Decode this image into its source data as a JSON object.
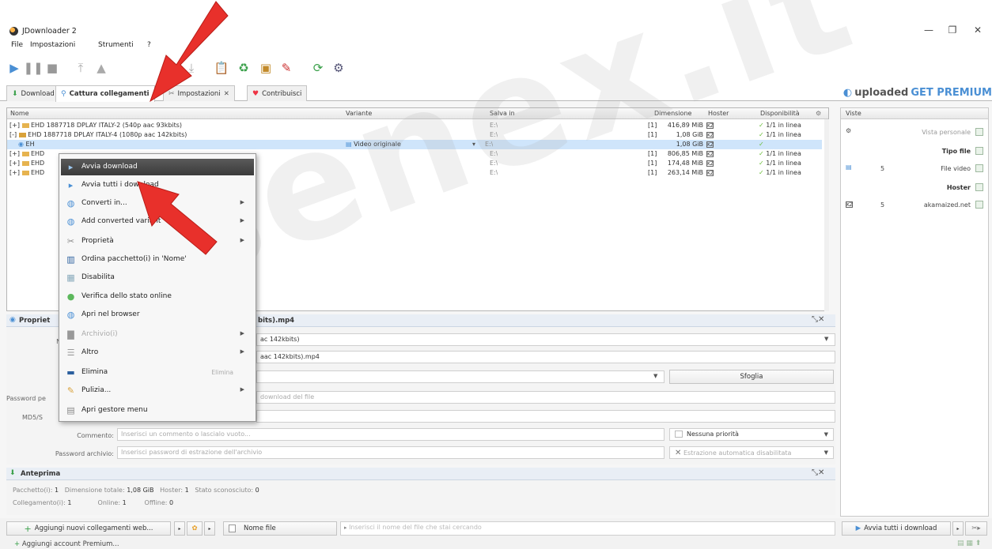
{
  "window": {
    "title": "JDownloader 2"
  },
  "menu": {
    "items": [
      "File",
      "Impostazioni",
      "Strumenti",
      "?"
    ]
  },
  "tabs": [
    {
      "label": "Download"
    },
    {
      "label": "Cattura collegamenti"
    },
    {
      "label": "Impostazioni"
    },
    {
      "label": "Contribuisci"
    }
  ],
  "promo": {
    "brand": "uploaded",
    "cta": "GET PREMIUM"
  },
  "grid": {
    "columns": [
      "Nome",
      "Variante",
      "Salva in",
      "Dimensione",
      "Hoster",
      "Disponibilità"
    ],
    "rows": [
      {
        "prefix": "[+]",
        "name": "EHD 1887718 DPLAY ITALY-2 (540p aac 93kbits)",
        "variant": "",
        "save": "E:\\",
        "count": "[1]",
        "size": "416,89 MiB",
        "hoster": "KZ",
        "avail": "1/1 in linea"
      },
      {
        "prefix": "[-]",
        "name": "EHD 1887718 DPLAY ITALY-4 (1080p aac 142kbits)",
        "variant": "",
        "save": "E:\\",
        "count": "[1]",
        "size": "1,08 GiB",
        "hoster": "KZ",
        "avail": "1/1 in linea"
      },
      {
        "prefix": "",
        "name": "EH",
        "variant": "Video originale",
        "save": "E:\\",
        "count": "",
        "size": "1,08 GiB",
        "hoster": "KZ",
        "avail": ""
      },
      {
        "prefix": "[+]",
        "name": "EHD",
        "variant": "",
        "save": "E:\\",
        "count": "[1]",
        "size": "806,85 MiB",
        "hoster": "KZ",
        "avail": "1/1 in linea"
      },
      {
        "prefix": "[+]",
        "name": "EHD",
        "variant": "",
        "save": "E:\\",
        "count": "[1]",
        "size": "174,48 MiB",
        "hoster": "KZ",
        "avail": "1/1 in linea"
      },
      {
        "prefix": "[+]",
        "name": "EHD",
        "variant": "",
        "save": "E:\\",
        "count": "[1]",
        "size": "263,14 MiB",
        "hoster": "KZ",
        "avail": "1/1 in linea"
      }
    ]
  },
  "side": {
    "header": "Viste",
    "rows": [
      {
        "label": "Vista personale",
        "count": ""
      },
      {
        "label": "Tipo file",
        "count": ""
      },
      {
        "label": "File video",
        "count": "5"
      },
      {
        "label": "Hoster",
        "count": ""
      },
      {
        "label": "akamaized.net",
        "count": "5"
      }
    ],
    "start_all": "Avvia tutti i download"
  },
  "context_menu": {
    "items": [
      {
        "label": "Avvia download",
        "icon": "play-icon"
      },
      {
        "label": "Avvia tutti i download",
        "icon": "play-all-icon"
      },
      {
        "label": "Converti in...",
        "icon": "convert-icon"
      },
      {
        "label": "Add converted variant",
        "icon": "add-variant-icon"
      },
      {
        "label": "Proprietà",
        "icon": "wrench-icon"
      },
      {
        "label": "Ordina pacchetto(i) in 'Nome'",
        "icon": "sort-icon"
      },
      {
        "label": "Disabilita",
        "icon": "disable-icon"
      },
      {
        "label": "Verifica dello stato online",
        "icon": "check-online-icon"
      },
      {
        "label": "Apri nel browser",
        "icon": "browser-icon"
      },
      {
        "label": "Archivio(i)",
        "icon": "archive-icon"
      },
      {
        "label": "Altro",
        "icon": "more-icon"
      },
      {
        "label": "Elimina",
        "icon": "delete-icon",
        "shortcut": "Elimina"
      },
      {
        "label": "Pulizia...",
        "icon": "broom-icon"
      },
      {
        "label": "Apri gestore menu",
        "icon": "menu-manager-icon"
      }
    ]
  },
  "props": {
    "title": "Propriet",
    "title_suffix": "bits).mp4",
    "name_label": "No",
    "row1_value": "ac 142kbits)",
    "row2_value": "aac 142kbits).mp4",
    "browse": "Sfoglia",
    "pw_label": "Password pe",
    "pw_placeholder": "download del file",
    "md5_label": "MD5/S",
    "comment_label": "Commento:",
    "comment_placeholder": "Inserisci un commento o lascialo vuoto...",
    "priority": "Nessuna priorità",
    "archive_pw_label": "Password archivio:",
    "archive_pw_placeholder": "Inserisci password di estrazione dell'archivio",
    "extraction": "Estrazione automatica disabilitata"
  },
  "preview": {
    "title": "Anteprima",
    "packages_label": "Pacchetto(i):",
    "packages": "1",
    "total_label": "Dimensione totale:",
    "total": "1,08 GiB",
    "hoster_label": "Hoster:",
    "hoster": "1",
    "unknown_label": "Stato sconosciuto:",
    "unknown": "0",
    "links_label": "Collegamento(i):",
    "links": "1",
    "online_label": "Online:",
    "online": "1",
    "offline_label": "Offline:",
    "offline": "0"
  },
  "bottom": {
    "add_links": "Aggiungi nuovi collegamenti web...",
    "filename": "Nome file",
    "search_placeholder": "Inserisci il nome del file che stai cercando",
    "add_premium": "Aggiungi account Premium..."
  },
  "watermark": "senex.it",
  "colors": {
    "accent": "#4a8fd4",
    "selection": "#cfe5fb",
    "arrow": "#e8302b"
  }
}
